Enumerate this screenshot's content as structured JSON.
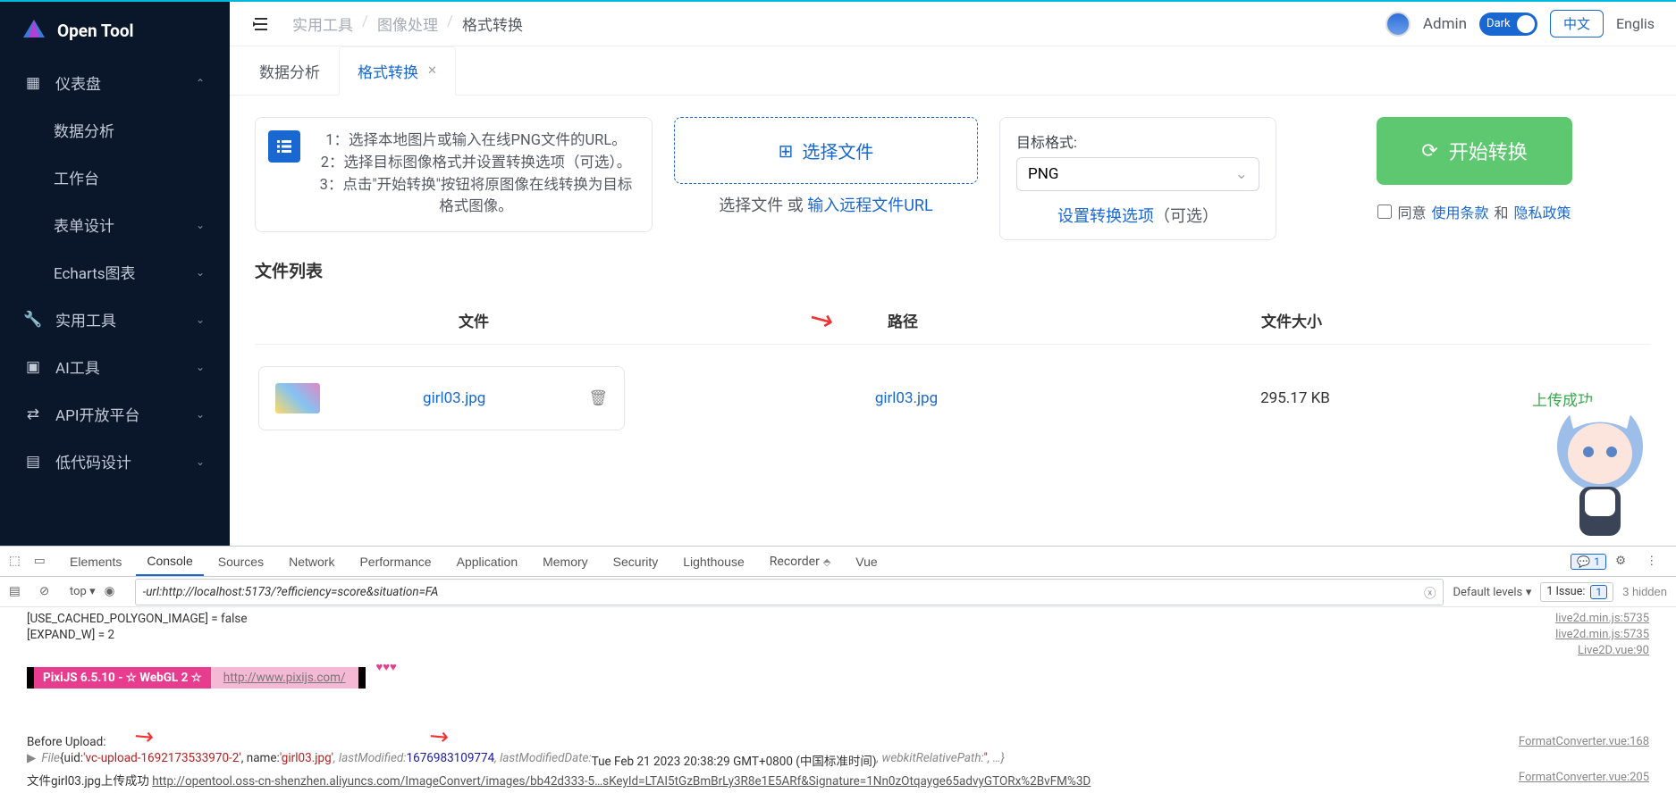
{
  "brand": "Open Tool",
  "sidebar": {
    "dashboard": "仪表盘",
    "subs": [
      "数据分析",
      "工作台",
      "表单设计",
      "Echarts图表"
    ],
    "items": [
      "实用工具",
      "AI工具",
      "API开放平台",
      "低代码设计"
    ]
  },
  "breadcrumb": [
    "实用工具",
    "图像处理",
    "格式转换"
  ],
  "header": {
    "admin": "Admin",
    "dark": "Dark",
    "lang_cn": "中文",
    "lang_en": "Englis"
  },
  "tabs": [
    {
      "label": "数据分析",
      "active": false
    },
    {
      "label": "格式转换",
      "active": true
    }
  ],
  "info_text": "1：选择本地图片或输入在线PNG文件的URL。 2：选择目标图像格式并设置转换选项（可选）。 3：点击\"开始转换\"按钮将原图像在线转换为目标格式图像。",
  "upload": {
    "btn": "选择文件",
    "sub_a": "选择文件 或 ",
    "sub_link": "输入远程文件URL"
  },
  "format": {
    "label": "目标格式:",
    "value": "PNG",
    "opt_link": "设置转换选项",
    "opt_tail": "（可选）"
  },
  "convert": {
    "btn": "开始转换",
    "agree_a": "同意",
    "terms": "使用条款",
    "and": "和",
    "privacy": "隐私政策"
  },
  "list": {
    "title": "文件列表",
    "cols": [
      "文件",
      "路径",
      "文件大小",
      ""
    ],
    "rows": [
      {
        "name": "girl03.jpg",
        "path": "girl03.jpg",
        "size": "295.17 KB",
        "status": "上传成功"
      }
    ]
  },
  "devtools": {
    "tabs": [
      "Elements",
      "Console",
      "Sources",
      "Network",
      "Performance",
      "Application",
      "Memory",
      "Security",
      "Lighthouse",
      "Recorder",
      "Vue"
    ],
    "active_tab": "Console",
    "top": "top",
    "filter": "-url:http://localhost:5173/?efficiency=score&situation=FA",
    "default_levels": "Default levels",
    "issue_label": "1 Issue:",
    "issue_count": "1",
    "hidden": "3 hidden",
    "badge_count": "1",
    "logs": {
      "l1": "[USE_CACHED_POLYGON_IMAGE] = false",
      "l1_src": "live2d.min.js:5735",
      "l2": "[EXPAND_W] = 2",
      "l2_src": "live2d.min.js:5735",
      "l3_src": "Live2D.vue:90",
      "pixi_a": "    PixiJS 6.5.10 - ☆ WebGL 2 ☆    ",
      "pixi_link": "http://www.pixijs.com/",
      "hearts": "♥♥♥",
      "before": "Before Upload:",
      "before_src": "FormatConverter.vue:168",
      "file_pre": " File {uid: ",
      "file_uid": "'vc-upload-1692173533970-2'",
      "file_name_k": ", name: ",
      "file_name_v": "'girl03.jpg'",
      "file_lm_k": ", lastModified: ",
      "file_lm_v": "1676983109774",
      "file_lmd_k": ", lastModifiedDate: ",
      "file_lmd_v": "Tue Feb 21 2023 20:38:29 GMT+0800 (中国标准时间)",
      "file_wrp_k": ", webkitRelativePath: ",
      "file_wrp_v": "''",
      "file_tail": ", …}",
      "success_a": "文件girl03.jpg上传成功 ",
      "success_url": "http://opentool.oss-cn-shenzhen.aliyuncs.com/ImageConvert/images/bb42d333-5…sKeyId=LTAI5tGzBmBrLy3R8e1E5ARf&Signature=1Nn0zOtqayge65advyGTORx%2BvFM%3D",
      "success_src": "FormatConverter.vue:205"
    }
  }
}
